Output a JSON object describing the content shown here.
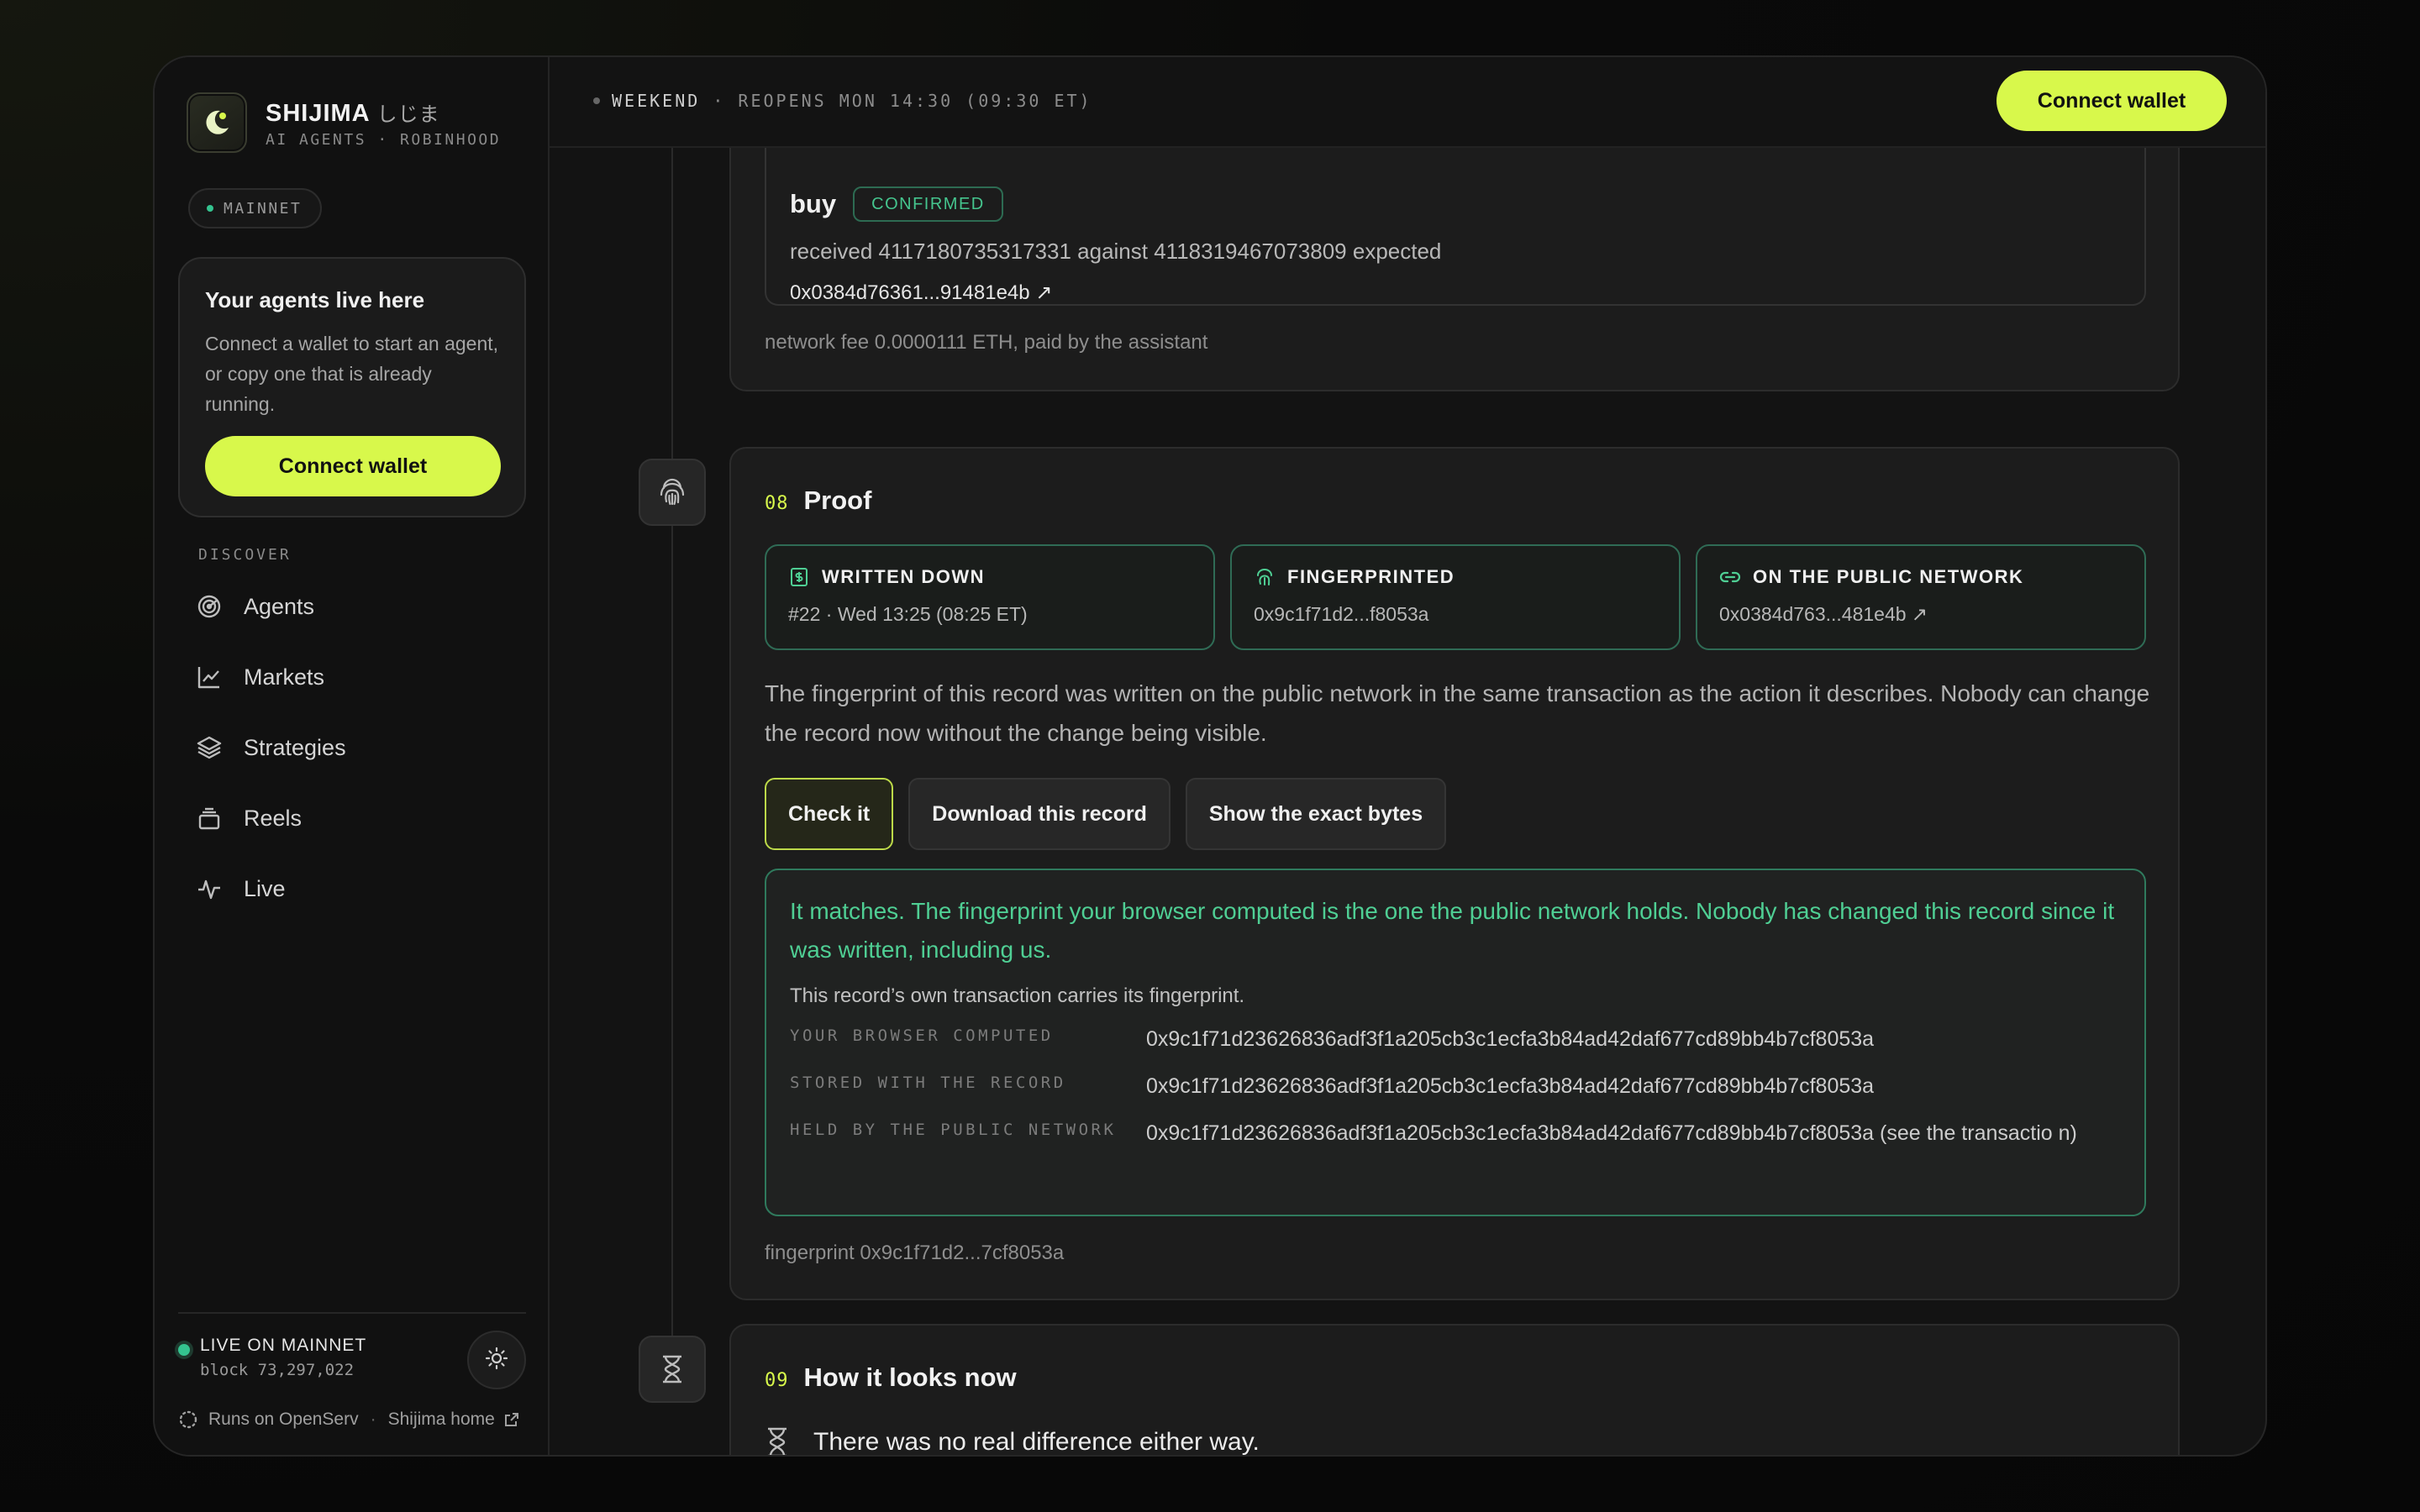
{
  "brand": {
    "name": "SHIJIMA",
    "name_jp": "しじま",
    "subtitle": "AI AGENTS · ROBINHOOD"
  },
  "network_pill": "MAINNET",
  "promo": {
    "title": "Your agents live here",
    "text": "Connect a wallet to start an agent, or copy one that is already running.",
    "button": "Connect wallet"
  },
  "sidebar": {
    "section_label": "DISCOVER",
    "items": [
      {
        "label": "Agents",
        "icon": "radar-icon"
      },
      {
        "label": "Markets",
        "icon": "line-chart-icon"
      },
      {
        "label": "Strategies",
        "icon": "layers-icon"
      },
      {
        "label": "Reels",
        "icon": "stack-icon"
      },
      {
        "label": "Live",
        "icon": "pulse-icon"
      }
    ],
    "footer": {
      "live_title": "LIVE ON MAINNET",
      "block": "block 73,297,022",
      "runs_on": "Runs on OpenServ",
      "separator": "·",
      "home_link": "Shijima home"
    }
  },
  "topbar": {
    "status_strong": "WEEKEND",
    "status_rest": " · REOPENS MON 14:30 (09:30 ET)",
    "connect_button": "Connect wallet"
  },
  "previous_step": {
    "action": "buy",
    "badge": "CONFIRMED",
    "received_text": "received 4117180735317331 against 4118319467073809 expected",
    "tx_link": "0x0384d76361...91481e4b ↗",
    "network_fee": "network fee 0.0000111 ETH, paid by the assistant"
  },
  "proof_step": {
    "number": "08",
    "title": "Proof",
    "boxes": [
      {
        "title": "WRITTEN DOWN",
        "value": "#22 · Wed 13:25 (08:25 ET)",
        "icon": "ledger-icon"
      },
      {
        "title": "FINGERPRINTED",
        "value": "0x9c1f71d2...f8053a",
        "icon": "fingerprint-icon"
      },
      {
        "title": "ON THE PUBLIC NETWORK",
        "value": "0x0384d763...481e4b ↗",
        "icon": "link-icon"
      }
    ],
    "paragraph": "The fingerprint of this record was written on the public network in the same transaction as the action it describes. Nobody can change the record now without the change being visible.",
    "actions": [
      "Check it",
      "Download this record",
      "Show the exact bytes"
    ],
    "result": {
      "title": "It matches. The fingerprint your browser computed is the one the public network holds. Nobody has changed this record since it was written, including us.",
      "subtitle": "This record’s own transaction carries its fingerprint.",
      "rows": [
        {
          "label": "YOUR BROWSER COMPUTED",
          "value": "0x9c1f71d23626836adf3f1a205cb3c1ecfa3b84ad42daf677cd89bb4b7cf8053a"
        },
        {
          "label": "STORED WITH THE RECORD",
          "value": "0x9c1f71d23626836adf3f1a205cb3c1ecfa3b84ad42daf677cd89bb4b7cf8053a"
        },
        {
          "label": "HELD BY THE PUBLIC NETWORK",
          "value": "0x9c1f71d23626836adf3f1a205cb3c1ecfa3b84ad42daf677cd89bb4b7cf8053a (see the transactio n)"
        }
      ]
    },
    "footer": "fingerprint 0x9c1f71d2...7cf8053a"
  },
  "now_step": {
    "number": "09",
    "title": "How it looks now",
    "text": "There was no real difference either way."
  },
  "colors": {
    "accent": "#d8f84b",
    "success": "#4fcf94",
    "background": "#131313"
  }
}
